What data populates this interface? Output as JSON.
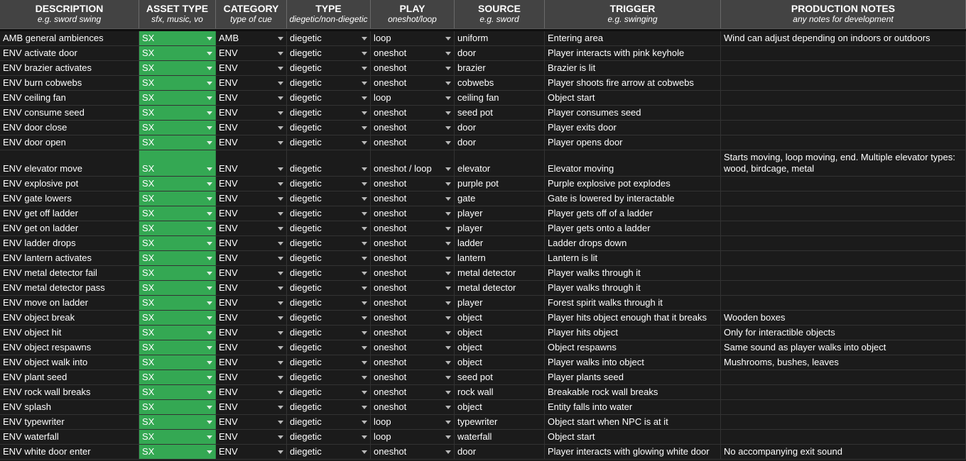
{
  "columns": [
    {
      "key": "description",
      "title": "DESCRIPTION",
      "subtitle": "e.g. sword swing"
    },
    {
      "key": "asset_type",
      "title": "ASSET TYPE",
      "subtitle": "sfx, music, vo"
    },
    {
      "key": "category",
      "title": "CATEGORY",
      "subtitle": "type of cue"
    },
    {
      "key": "type",
      "title": "TYPE",
      "subtitle": "diegetic/non-diegetic"
    },
    {
      "key": "play",
      "title": "PLAY",
      "subtitle": "oneshot/loop"
    },
    {
      "key": "source",
      "title": "SOURCE",
      "subtitle": "e.g. sword"
    },
    {
      "key": "trigger",
      "title": "TRIGGER",
      "subtitle": "e.g. swinging"
    },
    {
      "key": "notes",
      "title": "PRODUCTION NOTES",
      "subtitle": "any notes for development"
    }
  ],
  "colors": {
    "header_bg": "#434343",
    "cell_bg": "#1b1b1b",
    "asset_type_fill": "#34a853",
    "text": "#ffffff"
  },
  "rows": [
    {
      "description": "AMB general ambiences",
      "asset_type": "SX",
      "category": "AMB",
      "type": "diegetic",
      "play": "loop",
      "source": "uniform",
      "trigger": "Entering area",
      "notes": "Wind can adjust depending on indoors or outdoors"
    },
    {
      "description": "ENV activate door",
      "asset_type": "SX",
      "category": "ENV",
      "type": "diegetic",
      "play": "oneshot",
      "source": "door",
      "trigger": "Player interacts with pink keyhole",
      "notes": ""
    },
    {
      "description": "ENV brazier activates",
      "asset_type": "SX",
      "category": "ENV",
      "type": "diegetic",
      "play": "oneshot",
      "source": "brazier",
      "trigger": "Brazier is lit",
      "notes": ""
    },
    {
      "description": "ENV burn cobwebs",
      "asset_type": "SX",
      "category": "ENV",
      "type": "diegetic",
      "play": "oneshot",
      "source": "cobwebs",
      "trigger": "Player shoots fire arrow at cobwebs",
      "notes": ""
    },
    {
      "description": "ENV ceiling fan",
      "asset_type": "SX",
      "category": "ENV",
      "type": "diegetic",
      "play": "loop",
      "source": "ceiling fan",
      "trigger": "Object start",
      "notes": ""
    },
    {
      "description": "ENV consume seed",
      "asset_type": "SX",
      "category": "ENV",
      "type": "diegetic",
      "play": "oneshot",
      "source": "seed pot",
      "trigger": "Player consumes seed",
      "notes": ""
    },
    {
      "description": "ENV door close",
      "asset_type": "SX",
      "category": "ENV",
      "type": "diegetic",
      "play": "oneshot",
      "source": "door",
      "trigger": "Player exits door",
      "notes": ""
    },
    {
      "description": "ENV door open",
      "asset_type": "SX",
      "category": "ENV",
      "type": "diegetic",
      "play": "oneshot",
      "source": "door",
      "trigger": "Player opens door",
      "notes": ""
    },
    {
      "description": "ENV elevator move",
      "asset_type": "SX",
      "category": "ENV",
      "type": "diegetic",
      "play": "oneshot / loop",
      "source": "elevator",
      "trigger": "Elevator moving",
      "notes": "Starts moving, loop moving, end. Multiple elevator types: wood, birdcage, metal",
      "tall": true
    },
    {
      "description": "ENV explosive pot",
      "asset_type": "SX",
      "category": "ENV",
      "type": "diegetic",
      "play": "oneshot",
      "source": "purple pot",
      "trigger": "Purple explosive pot explodes",
      "notes": ""
    },
    {
      "description": "ENV gate lowers",
      "asset_type": "SX",
      "category": "ENV",
      "type": "diegetic",
      "play": "oneshot",
      "source": "gate",
      "trigger": "Gate is lowered by interactable",
      "notes": ""
    },
    {
      "description": "ENV get off ladder",
      "asset_type": "SX",
      "category": "ENV",
      "type": "diegetic",
      "play": "oneshot",
      "source": "player",
      "trigger": "Player gets off of a ladder",
      "notes": ""
    },
    {
      "description": "ENV get on ladder",
      "asset_type": "SX",
      "category": "ENV",
      "type": "diegetic",
      "play": "oneshot",
      "source": "player",
      "trigger": "Player gets onto a ladder",
      "notes": ""
    },
    {
      "description": "ENV ladder drops",
      "asset_type": "SX",
      "category": "ENV",
      "type": "diegetic",
      "play": "oneshot",
      "source": "ladder",
      "trigger": "Ladder drops down",
      "notes": ""
    },
    {
      "description": "ENV lantern activates",
      "asset_type": "SX",
      "category": "ENV",
      "type": "diegetic",
      "play": "oneshot",
      "source": "lantern",
      "trigger": "Lantern is lit",
      "notes": ""
    },
    {
      "description": "ENV metal detector fail",
      "asset_type": "SX",
      "category": "ENV",
      "type": "diegetic",
      "play": "oneshot",
      "source": "metal detector",
      "trigger": "Player walks through it",
      "notes": ""
    },
    {
      "description": "ENV metal detector pass",
      "asset_type": "SX",
      "category": "ENV",
      "type": "diegetic",
      "play": "oneshot",
      "source": "metal detector",
      "trigger": "Player walks through it",
      "notes": ""
    },
    {
      "description": "ENV move on ladder",
      "asset_type": "SX",
      "category": "ENV",
      "type": "diegetic",
      "play": "oneshot",
      "source": "player",
      "trigger": "Forest spirit walks through it",
      "notes": ""
    },
    {
      "description": "ENV object break",
      "asset_type": "SX",
      "category": "ENV",
      "type": "diegetic",
      "play": "oneshot",
      "source": "object",
      "trigger": "Player hits object enough that it breaks",
      "notes": "Wooden boxes"
    },
    {
      "description": "ENV object hit",
      "asset_type": "SX",
      "category": "ENV",
      "type": "diegetic",
      "play": "oneshot",
      "source": "object",
      "trigger": "Player hits object",
      "notes": "Only for interactible objects"
    },
    {
      "description": "ENV object respawns",
      "asset_type": "SX",
      "category": "ENV",
      "type": "diegetic",
      "play": "oneshot",
      "source": "object",
      "trigger": "Object respawns",
      "notes": "Same sound as player walks into object"
    },
    {
      "description": "ENV object walk into",
      "asset_type": "SX",
      "category": "ENV",
      "type": "diegetic",
      "play": "oneshot",
      "source": "object",
      "trigger": "Player walks into object",
      "notes": "Mushrooms, bushes, leaves"
    },
    {
      "description": "ENV plant seed",
      "asset_type": "SX",
      "category": "ENV",
      "type": "diegetic",
      "play": "oneshot",
      "source": "seed pot",
      "trigger": "Player plants seed",
      "notes": ""
    },
    {
      "description": "ENV rock wall breaks",
      "asset_type": "SX",
      "category": "ENV",
      "type": "diegetic",
      "play": "oneshot",
      "source": "rock wall",
      "trigger": "Breakable rock wall breaks",
      "notes": ""
    },
    {
      "description": "ENV splash",
      "asset_type": "SX",
      "category": "ENV",
      "type": "diegetic",
      "play": "oneshot",
      "source": "object",
      "trigger": "Entity falls into water",
      "notes": ""
    },
    {
      "description": "ENV typewriter",
      "asset_type": "SX",
      "category": "ENV",
      "type": "diegetic",
      "play": "loop",
      "source": "typewriter",
      "trigger": "Object start when NPC is at it",
      "notes": ""
    },
    {
      "description": "ENV waterfall",
      "asset_type": "SX",
      "category": "ENV",
      "type": "diegetic",
      "play": "loop",
      "source": "waterfall",
      "trigger": "Object start",
      "notes": ""
    },
    {
      "description": "ENV white door enter",
      "asset_type": "SX",
      "category": "ENV",
      "type": "diegetic",
      "play": "oneshot",
      "source": "door",
      "trigger": "Player interacts with glowing white door",
      "notes": "No accompanying exit sound"
    }
  ]
}
